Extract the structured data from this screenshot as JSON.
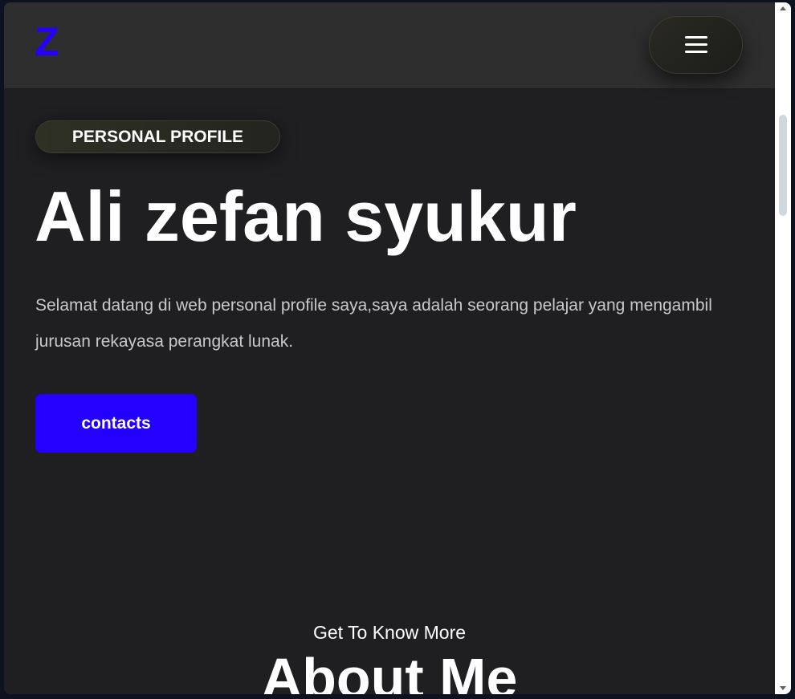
{
  "navbar": {
    "logo": "Z",
    "menu_icon": "hamburger-menu-icon"
  },
  "hero": {
    "badge": "PERSONAL PROFILE",
    "title": "Ali zefan syukur",
    "description": "Selamat datang di web personal profile saya,saya adalah seorang pelajar yang mengambil jurusan rekayasa perangkat lunak.",
    "cta_label": "contacts"
  },
  "about": {
    "subtitle": "Get To Know More",
    "title": "About Me"
  },
  "colors": {
    "accent": "#2300ff",
    "background": "#1f1e21",
    "navbar": "#2e2e2e",
    "text": "#ffffff",
    "muted_text": "#c8c8c8"
  }
}
